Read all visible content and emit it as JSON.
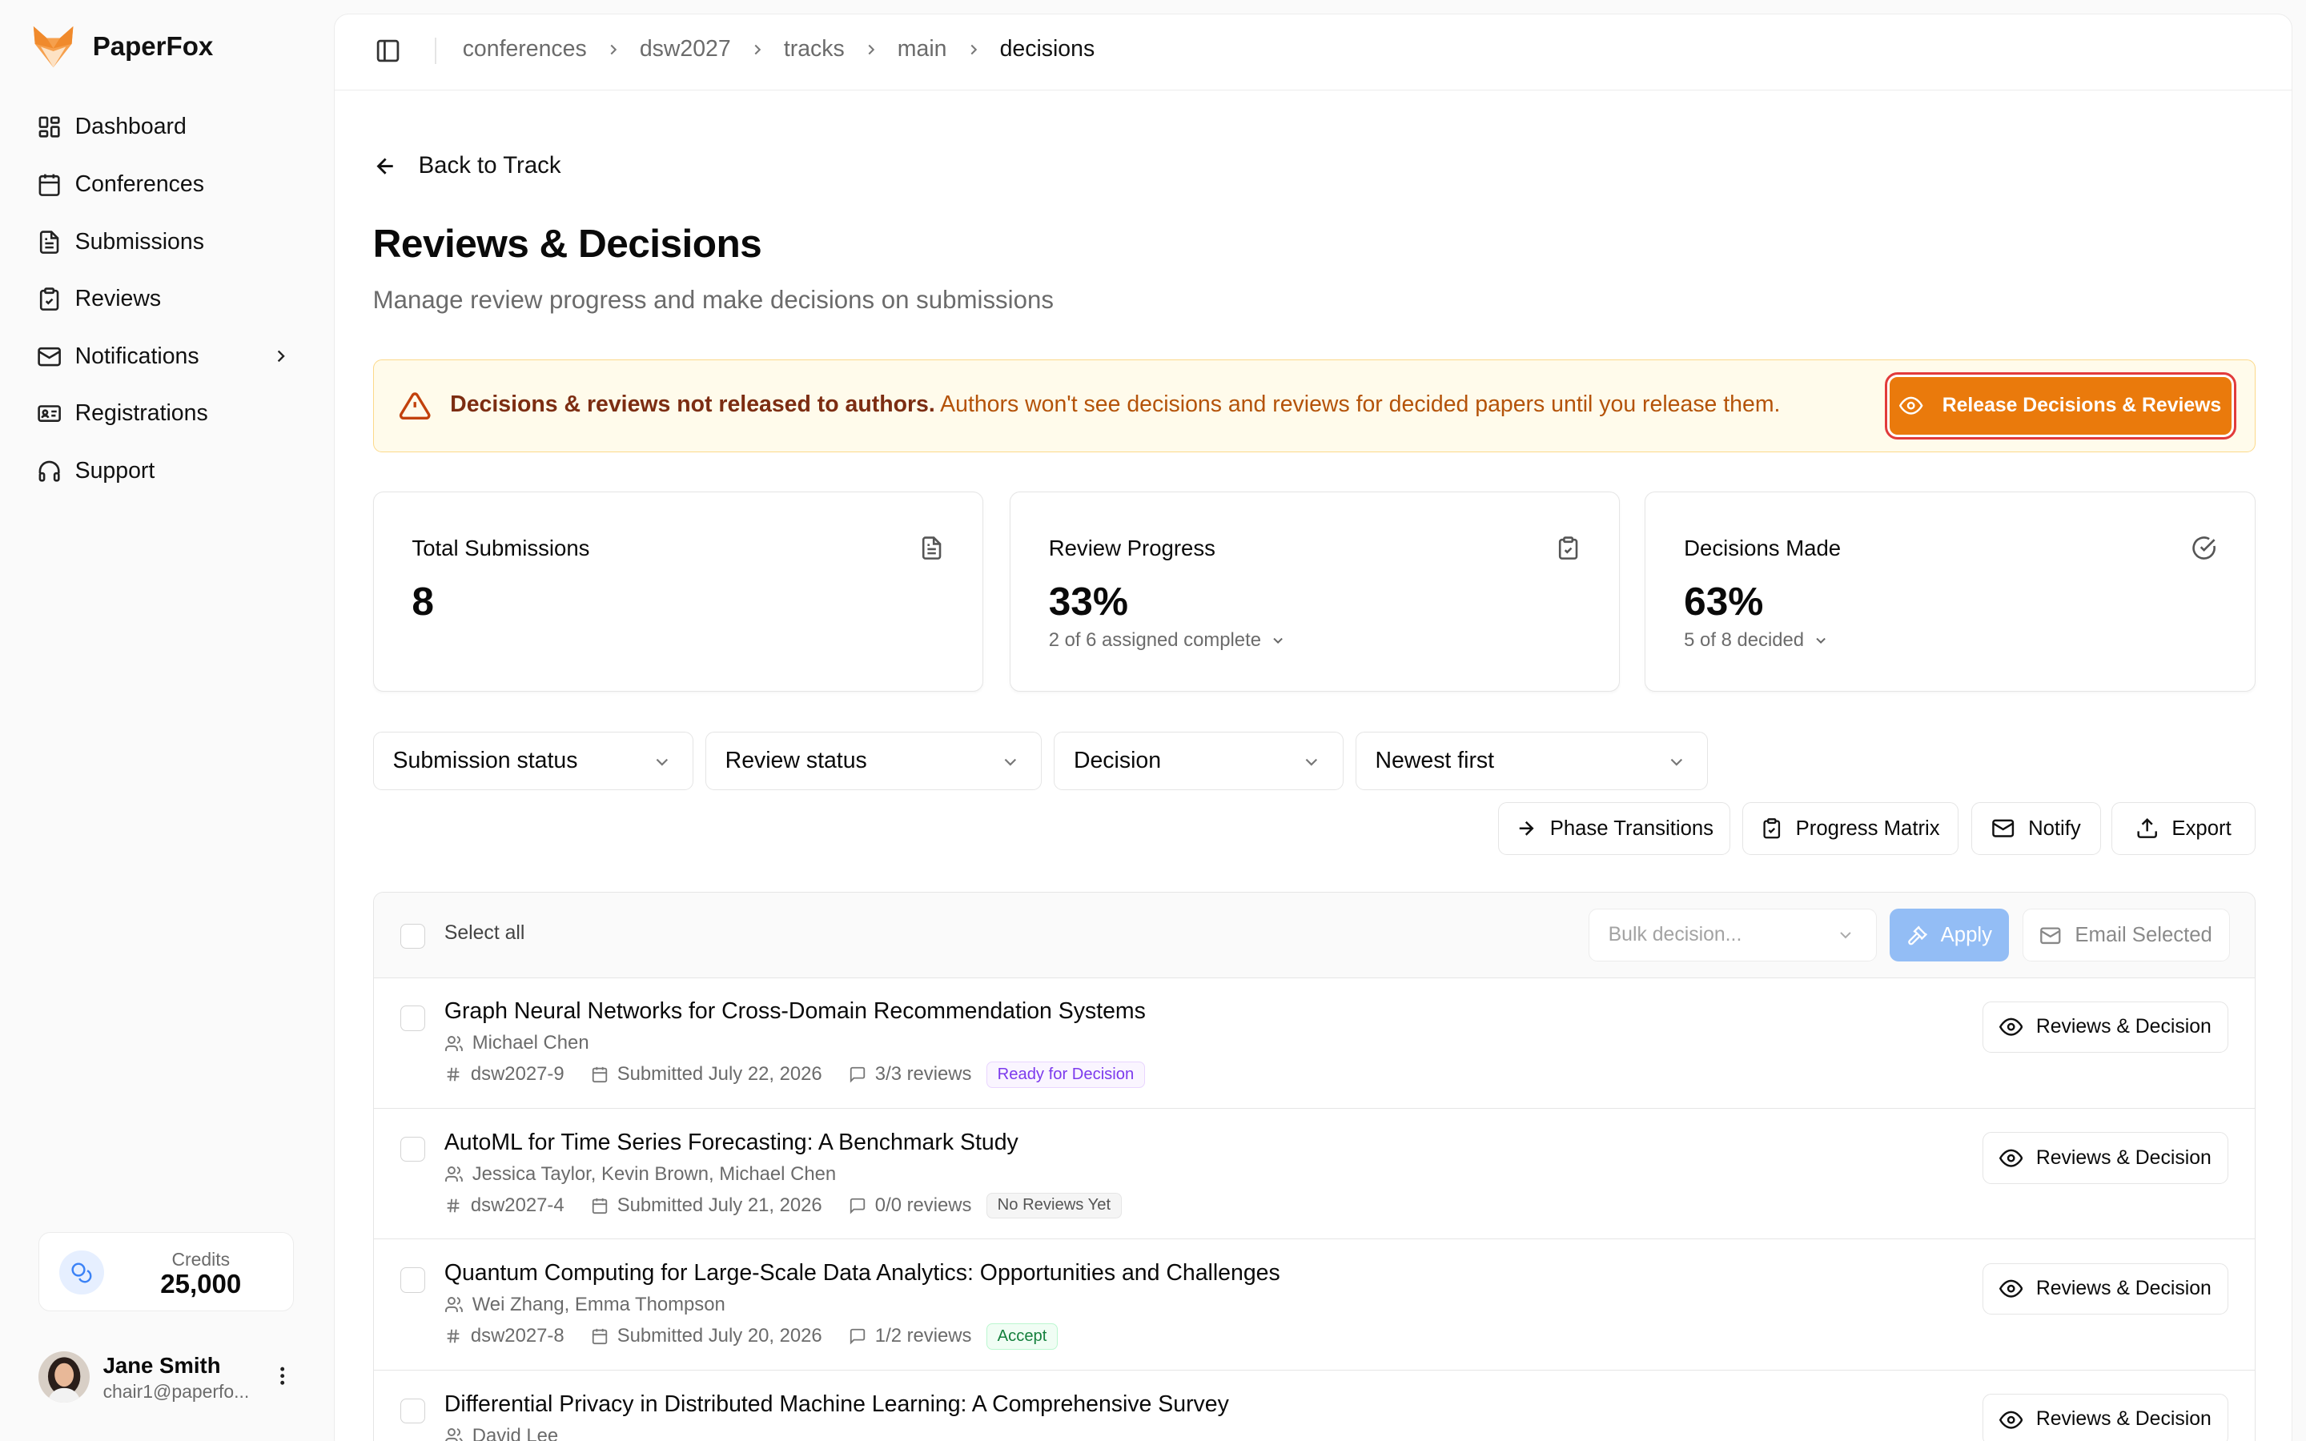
{
  "app": {
    "name": "PaperFox"
  },
  "sidebar": {
    "items": [
      {
        "label": "Dashboard"
      },
      {
        "label": "Conferences"
      },
      {
        "label": "Submissions"
      },
      {
        "label": "Reviews"
      },
      {
        "label": "Notifications"
      },
      {
        "label": "Registrations"
      },
      {
        "label": "Support"
      }
    ],
    "credits_label": "Credits",
    "credits_value": "25,000",
    "user_name": "Jane Smith",
    "user_email": "chair1@paperfo..."
  },
  "breadcrumb": [
    "conferences",
    "dsw2027",
    "tracks",
    "main",
    "decisions"
  ],
  "page": {
    "back_label": "Back to Track",
    "title": "Reviews & Decisions",
    "subtitle": "Manage review progress and make decisions on submissions"
  },
  "alert": {
    "strong": "Decisions & reviews not released to authors.",
    "text": "Authors won't see decisions and reviews for decided papers until you release them.",
    "button": "Release Decisions & Reviews"
  },
  "stats": [
    {
      "label": "Total Submissions",
      "value": "8",
      "sub": ""
    },
    {
      "label": "Review Progress",
      "value": "33%",
      "sub": "2 of 6 assigned complete"
    },
    {
      "label": "Decisions Made",
      "value": "63%",
      "sub": "5 of 8 decided"
    }
  ],
  "filters": [
    "Submission status",
    "Review status",
    "Decision",
    "Newest first"
  ],
  "actions": [
    "Phase Transitions",
    "Progress Matrix",
    "Notify",
    "Export"
  ],
  "list": {
    "select_all": "Select all",
    "bulk_placeholder": "Bulk decision...",
    "apply": "Apply",
    "email_selected": "Email Selected",
    "row_button": "Reviews & Decision",
    "rows": [
      {
        "title": "Graph Neural Networks for Cross-Domain Recommendation Systems",
        "authors": "Michael Chen",
        "id": "dsw2027-9",
        "submitted": "Submitted July 22, 2026",
        "reviews": "3/3 reviews",
        "badge": "Ready for Decision"
      },
      {
        "title": "AutoML for Time Series Forecasting: A Benchmark Study",
        "authors": "Jessica Taylor, Kevin Brown, Michael Chen",
        "id": "dsw2027-4",
        "submitted": "Submitted July 21, 2026",
        "reviews": "0/0 reviews",
        "badge": "No Reviews Yet"
      },
      {
        "title": "Quantum Computing for Large-Scale Data Analytics: Opportunities and Challenges",
        "authors": "Wei Zhang, Emma Thompson",
        "id": "dsw2027-8",
        "submitted": "Submitted July 20, 2026",
        "reviews": "1/2 reviews",
        "badge": "Accept"
      },
      {
        "title": "Differential Privacy in Distributed Machine Learning: A Comprehensive Survey",
        "authors": "David Lee",
        "id": "",
        "submitted": "",
        "reviews": "",
        "badge": ""
      }
    ]
  },
  "colors": {
    "accent": "#ea7a0c",
    "alert_bg": "#fffbeb",
    "primary_light": "#93bdf5"
  }
}
